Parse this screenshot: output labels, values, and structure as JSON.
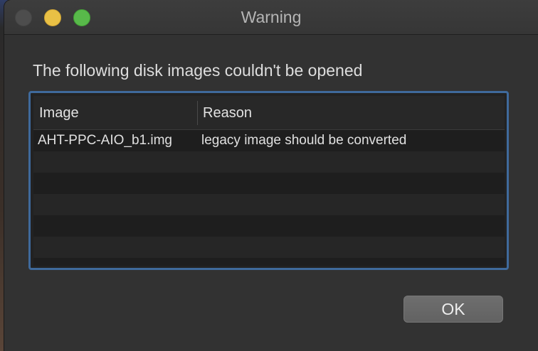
{
  "window": {
    "title": "Warning"
  },
  "dialog": {
    "message": "The following disk images couldn't be opened",
    "table": {
      "columns": [
        "Image",
        "Reason"
      ],
      "rows": [
        {
          "image": "AHT-PPC-AIO_b1.img",
          "reason": "legacy image should be converted"
        }
      ]
    },
    "ok_label": "OK"
  },
  "colors": {
    "accent_border": "#3f6a9c",
    "traffic_close": "#4d4d4d",
    "traffic_minimize": "#e9c045",
    "traffic_zoom": "#58b94a"
  }
}
